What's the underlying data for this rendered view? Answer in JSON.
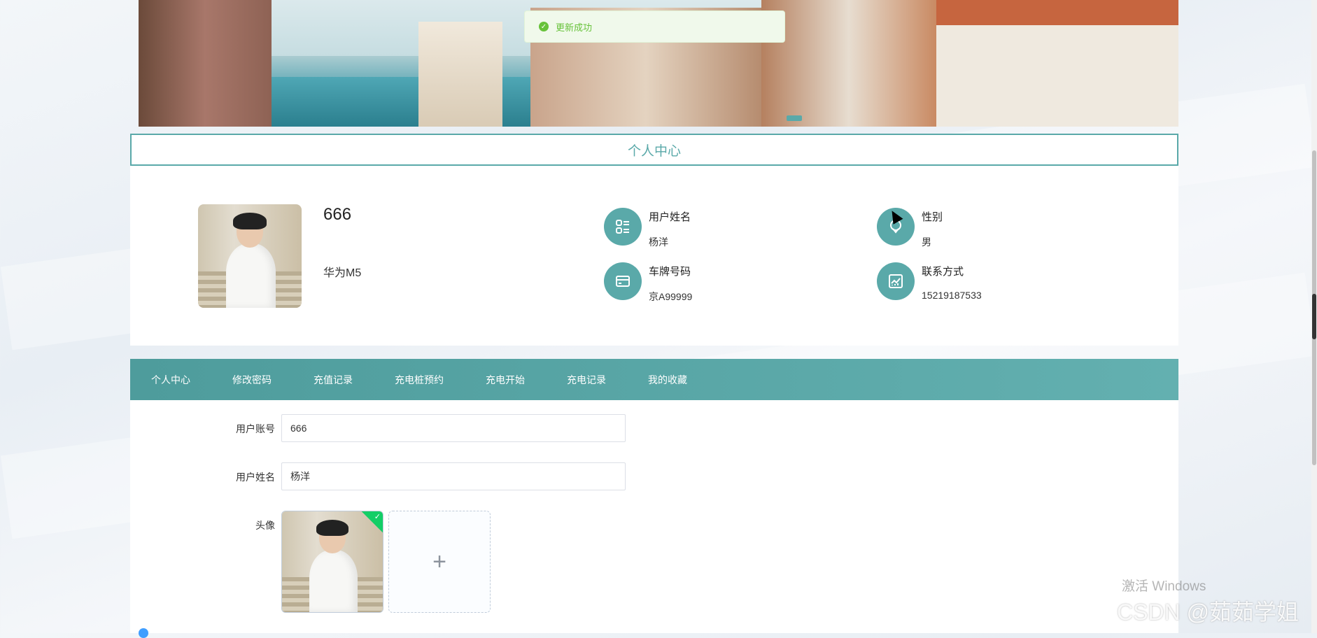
{
  "toast": {
    "message": "更新成功",
    "icon": "success-check-icon",
    "color": "#67c23a"
  },
  "panel": {
    "title": "个人中心",
    "accent": "#5aa9a9"
  },
  "profile": {
    "username": "666",
    "car_model": "华为M5",
    "fields": [
      {
        "label": "用户姓名",
        "value": "杨洋",
        "icon": "id-card-icon"
      },
      {
        "label": "性别",
        "value": "男",
        "icon": "gender-icon"
      },
      {
        "label": "车牌号码",
        "value": "京A99999",
        "icon": "license-plate-icon"
      },
      {
        "label": "联系方式",
        "value": "15219187533",
        "icon": "contact-chart-icon"
      }
    ]
  },
  "tabs": [
    "个人中心",
    "修改密码",
    "充值记录",
    "充电桩预约",
    "充电开始",
    "充电记录",
    "我的收藏"
  ],
  "form": {
    "account_label": "用户账号",
    "account_value": "666",
    "name_label": "用户姓名",
    "name_value": "杨洋",
    "avatar_label": "头像",
    "upload_symbol": "+"
  },
  "watermark": {
    "os_text": "激活 Windows",
    "brand": "CSDN @茹茹学姐"
  }
}
